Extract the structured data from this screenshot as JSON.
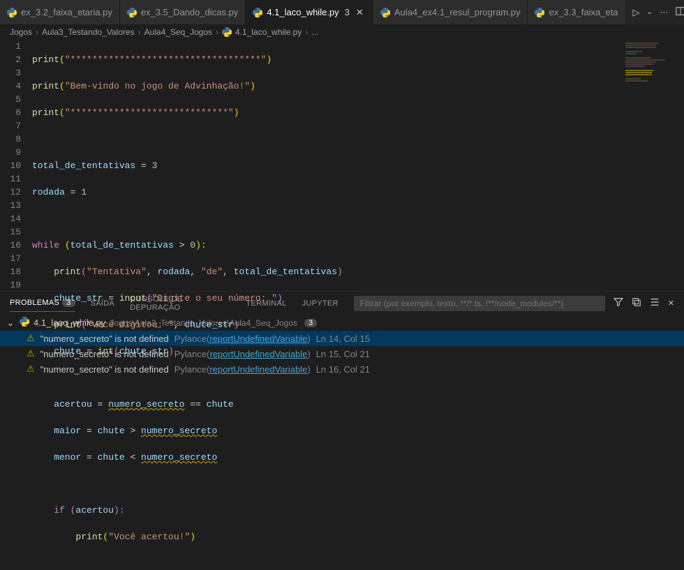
{
  "tabs": [
    {
      "label": "ex_3.2_faixa_etaria.py"
    },
    {
      "label": "ex_3.5_Dando_dicas.py"
    },
    {
      "label": "4.1_laco_while.py",
      "active": true,
      "dirty": "3",
      "closable": true
    },
    {
      "label": "Aula4_ex4.1_resul_program.py"
    },
    {
      "label": "ex_3.3_faixa_eta"
    }
  ],
  "breadcrumb": {
    "p1": "Jogos",
    "p2": "Aula3_Testando_Valores",
    "p3": "Aula4_Seq_Jogos",
    "p4": "4.1_laco_while.py",
    "p5": "..."
  },
  "code": {
    "l1a": "print",
    "l1b": "(",
    "l1c": "\"***********************************\"",
    "l1d": ")",
    "l2a": "print",
    "l2b": "(",
    "l2c": "\"Bem-vindo no jogo de Advinhação!\"",
    "l2d": ")",
    "l3a": "print",
    "l3b": "(",
    "l3c": "\"*****************************\"",
    "l3d": ")",
    "l5a": "total_de_tentativas",
    "l5b": " = ",
    "l5c": "3",
    "l6a": "rodada",
    "l6b": " = ",
    "l6c": "1",
    "l8a": "while",
    "l8b": " (",
    "l8c": "total_de_tentativas",
    "l8d": " > ",
    "l8e": "0",
    "l8f": "):",
    "l9a": "    print",
    "l9b": "(",
    "l9c": "\"Tentativa\"",
    "l9d": ", ",
    "l9e": "rodada",
    "l9f": ", ",
    "l9g": "\"de\"",
    "l9h": ", ",
    "l9i": "total_de_tentativas",
    "l9j": ")",
    "l10a": "    chute_str",
    "l10b": " = ",
    "l10c": "input",
    "l10d": "(",
    "l10e": "\"Digite o seu número: \"",
    "l10f": ")",
    "l11a": "    print",
    "l11b": "(",
    "l11c": "\"Você digitou: \"",
    "l11d": ", ",
    "l11e": "chute_str",
    "l11f": ")",
    "l12a": "    chute",
    "l12b": " = ",
    "l12c": "int",
    "l12d": "(",
    "l12e": "chute_str",
    "l12f": ")",
    "l14a": "    acertou",
    "l14b": " = ",
    "l14c": "numero_secreto",
    "l14d": " == ",
    "l14e": "chute",
    "l15a": "    maior",
    "l15b": " = ",
    "l15c": "chute",
    "l15d": " > ",
    "l15e": "numero_secreto",
    "l16a": "    menor",
    "l16b": " = ",
    "l16c": "chute",
    "l16d": " < ",
    "l16e": "numero_secreto",
    "l18a": "    if",
    "l18b": " (",
    "l18c": "acertou",
    "l18d": "):",
    "l19a": "        print",
    "l19b": "(",
    "l19c": "\"Você acertou!\"",
    "l19d": ")"
  },
  "lines": [
    "1",
    "2",
    "3",
    "4",
    "5",
    "6",
    "7",
    "8",
    "9",
    "10",
    "11",
    "12",
    "13",
    "14",
    "15",
    "16",
    "17",
    "18",
    "19"
  ],
  "panel": {
    "tabs": {
      "problemas": "PROBLEMAS",
      "badge": "3",
      "saida": "SAÍDA",
      "depuracao": "CONSOLE DE DEPURAÇÃO",
      "terminal": "TERMINAL",
      "jupyter": "JUPYTER"
    },
    "filter_placeholder": "Filtrar (por exemplo, texto, **/*.ts, !**/node_modules/**)"
  },
  "problems": {
    "file": "4.1_laco_while.py",
    "path": "Jogos\\Aula3_Testando_Valores\\Aula4_Seq_Jogos",
    "count": "3",
    "rows": [
      {
        "msg": "\"numero_secreto\" is not defined",
        "src": "Pylance",
        "link": "reportUndefinedVariable",
        "loc": "Ln 14, Col 15"
      },
      {
        "msg": "\"numero_secreto\" is not defined",
        "src": "Pylance",
        "link": "reportUndefinedVariable",
        "loc": "Ln 15, Col 21"
      },
      {
        "msg": "\"numero_secreto\" is not defined",
        "src": "Pylance",
        "link": "reportUndefinedVariable",
        "loc": "Ln 16, Col 21"
      }
    ]
  }
}
